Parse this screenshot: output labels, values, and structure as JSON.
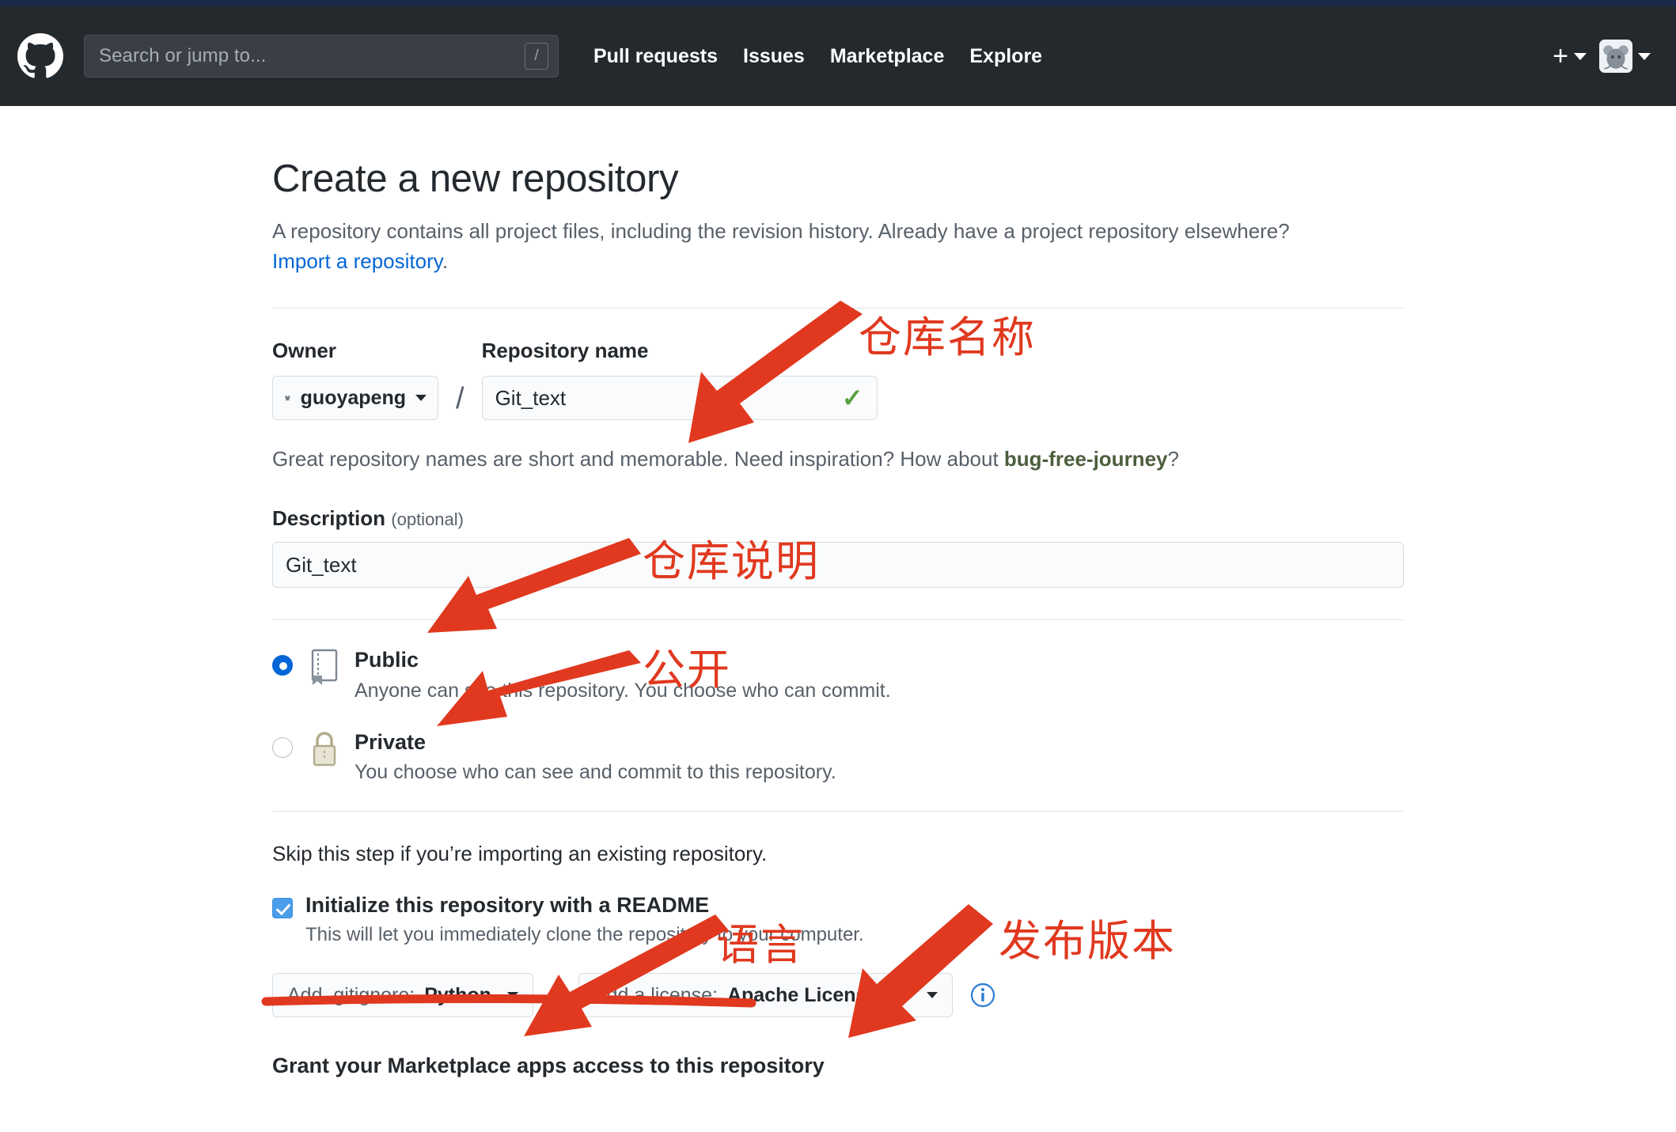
{
  "header": {
    "logo_icon": "github-mark-icon",
    "search_placeholder": "Search or jump to...",
    "search_value": "",
    "slash_key": "/",
    "nav": [
      {
        "label": "Pull requests"
      },
      {
        "label": "Issues"
      },
      {
        "label": "Marketplace"
      },
      {
        "label": "Explore"
      }
    ],
    "plus_icon": "plus-icon",
    "avatar_icon": "user-avatar"
  },
  "page": {
    "title": "Create a new repository",
    "subtitle_part1": "A repository contains all project files, including the revision history. Already have a project repository elsewhere? ",
    "import_link": "Import a repository",
    "subtitle_end": "."
  },
  "form": {
    "owner_label": "Owner",
    "owner_value": "guoyapeng",
    "separator": "/",
    "repo_name_label": "Repository name",
    "repo_name_value": "Git_text",
    "repo_valid_icon": "check-icon",
    "hint_before": "Great repository names are short and memorable. Need inspiration? How about ",
    "hint_suggestion": "bug-free-journey",
    "hint_after": "?",
    "description_label": "Description",
    "description_optional": "(optional)",
    "description_value": "Git_text",
    "visibility": [
      {
        "id": "public",
        "icon": "repo-book-icon",
        "title": "Public",
        "desc": "Anyone can see this repository. You choose who can commit.",
        "selected": true
      },
      {
        "id": "private",
        "icon": "lock-icon",
        "title": "Private",
        "desc": "You choose who can see and commit to this repository.",
        "selected": false
      }
    ],
    "skip_text": "Skip this step if you’re importing an existing repository.",
    "readme_checked": true,
    "readme_title": "Initialize this repository with a README",
    "readme_desc": "This will let you immediately clone the repository to your computer.",
    "gitignore_prefix": "Add .gitignore: ",
    "gitignore_value": "Python",
    "license_prefix": "Add a license: ",
    "license_value": "Apache License 2.0",
    "info_icon": "info-icon",
    "grant_heading": "Grant your Marketplace apps access to this repository"
  },
  "annotations": {
    "color": "#e0391f",
    "items": [
      {
        "id": "repo-name",
        "text": "仓库名称"
      },
      {
        "id": "description",
        "text": "仓库说明"
      },
      {
        "id": "public",
        "text": "公开"
      },
      {
        "id": "language",
        "text": "语言"
      },
      {
        "id": "release",
        "text": "发布版本"
      }
    ]
  }
}
